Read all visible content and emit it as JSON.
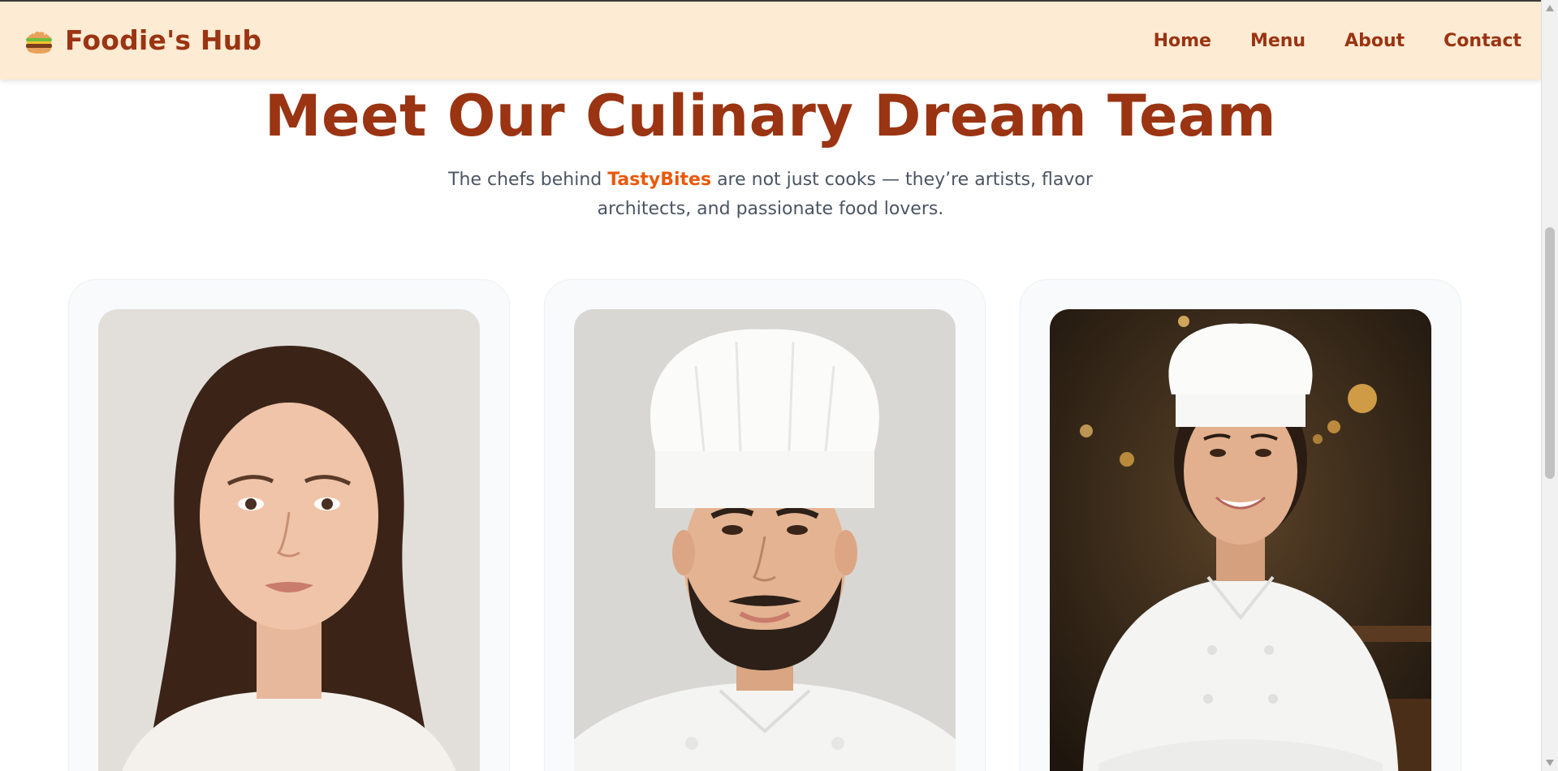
{
  "header": {
    "brand_emoji": "🍔",
    "brand_name": "Foodie's Hub",
    "nav": [
      {
        "label": "Home"
      },
      {
        "label": "Menu"
      },
      {
        "label": "About"
      },
      {
        "label": "Contact"
      }
    ]
  },
  "hero": {
    "title": "Meet Our Culinary Dream Team",
    "subtitle_pre": "The chefs behind ",
    "subtitle_brand": "TastyBites",
    "subtitle_post": " are not just cooks — they’re artists, flavor architects, and passionate food lovers."
  },
  "team": [
    {
      "photo_icon": "woman-portrait",
      "accent": "#3b2417"
    },
    {
      "photo_icon": "chef-man-portrait",
      "accent": "#ffffff"
    },
    {
      "photo_icon": "chef-woman-portrait",
      "accent": "#3a2a1a"
    }
  ],
  "colors": {
    "brand": "#9a3412",
    "highlight": "#ea580c",
    "nav_bg": "#fdebd3",
    "text_muted": "#4b5563"
  }
}
